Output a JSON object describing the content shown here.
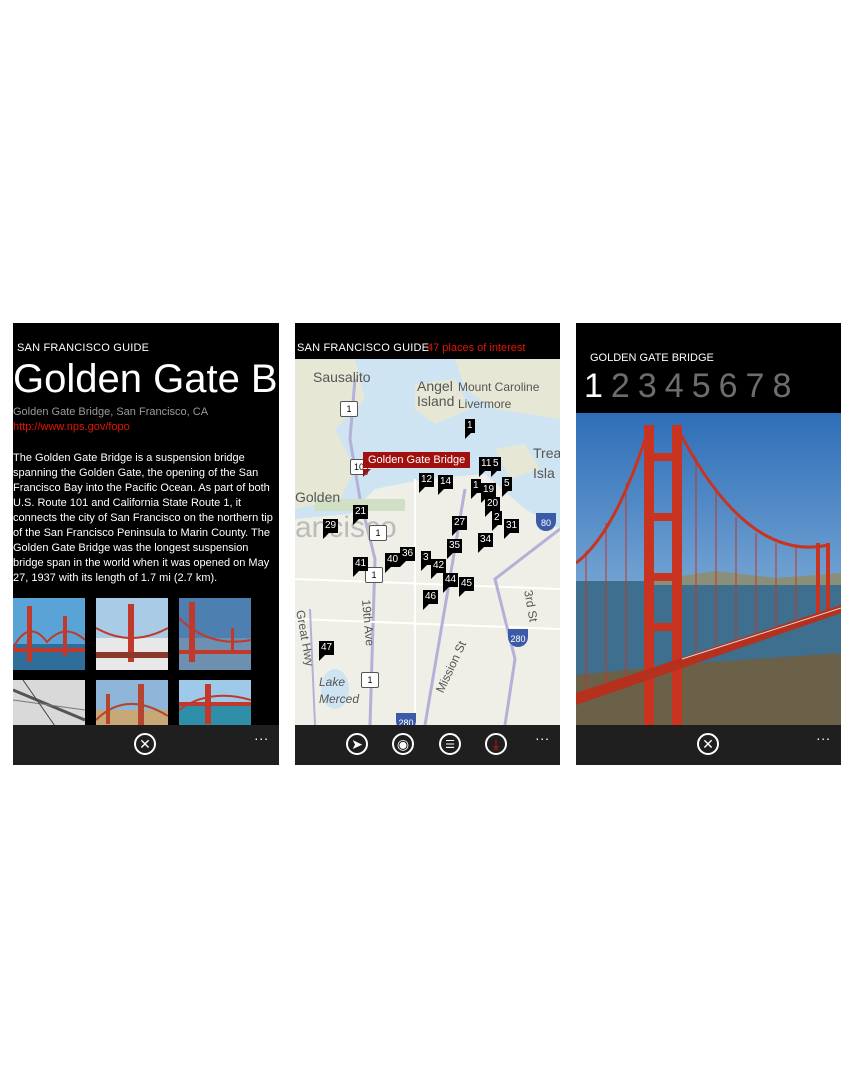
{
  "panel1": {
    "app_title": "SAN FRANCISCO GUIDE",
    "title": "Golden Gate Bri",
    "address": "Golden Gate Bridge, San Francisco, CA",
    "link": "http://www.nps.gov/fopo",
    "description": "The Golden Gate Bridge is a suspension bridge spanning the Golden Gate, the opening of the San Francisco Bay into the Pacific Ocean. As part of both U.S. Route 101 and California State Route 1, it connects the city of San Francisco on the northern tip of the San Francisco Peninsula to Marin County. The Golden Gate Bridge was the longest suspension bridge span in the world when it was opened on May 27, 1937 with its length of 1.7 mi (2.7 km).",
    "appbar": {
      "close_icon": "close-icon",
      "more": "..."
    }
  },
  "panel2": {
    "app_title": "SAN FRANCISCO GUIDE",
    "count": "47 places of interest",
    "callout": "Golden Gate Bridge",
    "map_labels": {
      "sausalito": "Sausalito",
      "angel_island": "Angel Island",
      "mount_caroline": "Mount Caroline Livermore",
      "treasure": "Trea Isla",
      "golden": "Golden",
      "francisco": "ancisco",
      "great_hwy": "Great Hwy",
      "nineteenth": "19th Ave",
      "mission": "Mission St",
      "third": "3rd St",
      "lake_merced": "Lake Merced"
    },
    "pins": [
      "1",
      "11",
      "5",
      "12",
      "14",
      "1",
      "19",
      "5",
      "20",
      "21",
      "29",
      "27",
      "2",
      "31",
      "35",
      "34",
      "41",
      "40",
      "36",
      "3",
      "42",
      "44",
      "45",
      "46",
      "47"
    ],
    "route_shields": [
      "1",
      "10",
      "1",
      "1",
      "1"
    ],
    "interstates": [
      "80",
      "280",
      "280"
    ],
    "appbar": {
      "more": "..."
    }
  },
  "panel3": {
    "title": "GOLDEN GATE BRIDGE",
    "pivots": [
      "1",
      "2",
      "3",
      "4",
      "5",
      "6",
      "7",
      "8"
    ],
    "active_pivot": "1",
    "appbar": {
      "more": "..."
    }
  },
  "colors": {
    "accent": "#e51400",
    "callout": "#a20f0f",
    "background": "#000000"
  }
}
